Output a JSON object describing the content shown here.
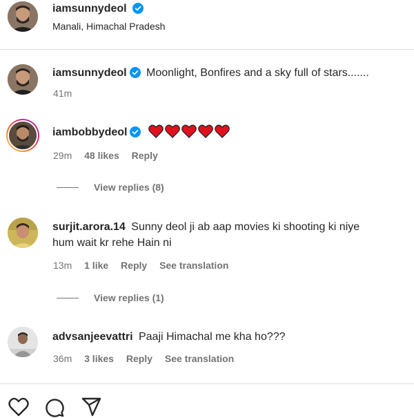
{
  "post": {
    "author": "iamsunnydeol",
    "location": "Manali, Himachal Pradesh"
  },
  "caption": {
    "author": "iamsunnydeol",
    "text": "Moonlight, Bonfires and a sky full of stars.......",
    "time": "41m"
  },
  "comments": [
    {
      "author": "iambobbydeol",
      "text": "",
      "emoji_hearts": 5,
      "time": "29m",
      "likes": "48 likes",
      "reply": "Reply",
      "view_replies": "View replies (8)"
    },
    {
      "author": "surjit.arora.14",
      "text_line1": "Sunny deol ji ab aap movies ki shooting ki niye",
      "text_line2": "hum wait kr rehe Hain ni",
      "time": "13m",
      "likes": "1 like",
      "reply": "Reply",
      "translation": "See translation",
      "view_replies": "View replies (1)"
    },
    {
      "author": "advsanjeevattri",
      "text": "Paaji Himachal me kha ho???",
      "time": "36m",
      "likes": "3 likes",
      "reply": "Reply",
      "translation": "See translation"
    }
  ],
  "colors": {
    "verified": "#0095f6",
    "heart": "#e0111f",
    "muted": "#737373",
    "story_ring": "#d6249f"
  },
  "icons": [
    "heart-icon",
    "comment-icon",
    "share-icon",
    "verified-badge-icon"
  ]
}
